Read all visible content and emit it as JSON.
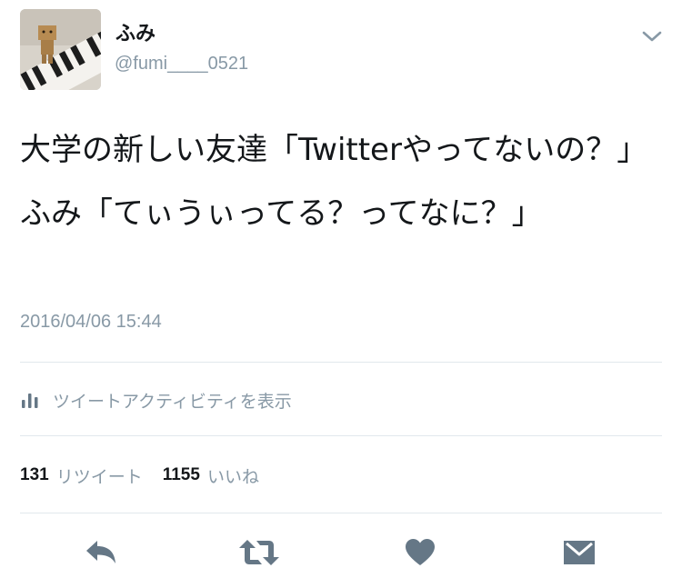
{
  "user": {
    "display_name": "ふみ",
    "handle": "@fumi____0521"
  },
  "tweet": {
    "lines": [
      "大学の新しい友達「Twitterやってないの？」",
      "ふみ「てぃうぃってる？ってなに？」"
    ],
    "timestamp": "2016/04/06 15:44"
  },
  "activity": {
    "label": "ツイートアクティビティを表示",
    "icon": "bar-chart-icon"
  },
  "stats": {
    "retweet_count": "131",
    "retweet_label": "リツイート",
    "like_count": "1155",
    "like_label": "いいね"
  },
  "actions": [
    {
      "name": "reply",
      "icon": "reply-icon"
    },
    {
      "name": "retweet",
      "icon": "retweet-icon"
    },
    {
      "name": "like",
      "icon": "heart-icon"
    },
    {
      "name": "message",
      "icon": "envelope-icon"
    }
  ],
  "colors": {
    "text": "#14171a",
    "secondary": "#8899a6",
    "icon": "#657786",
    "divider": "#e1e8ed"
  }
}
